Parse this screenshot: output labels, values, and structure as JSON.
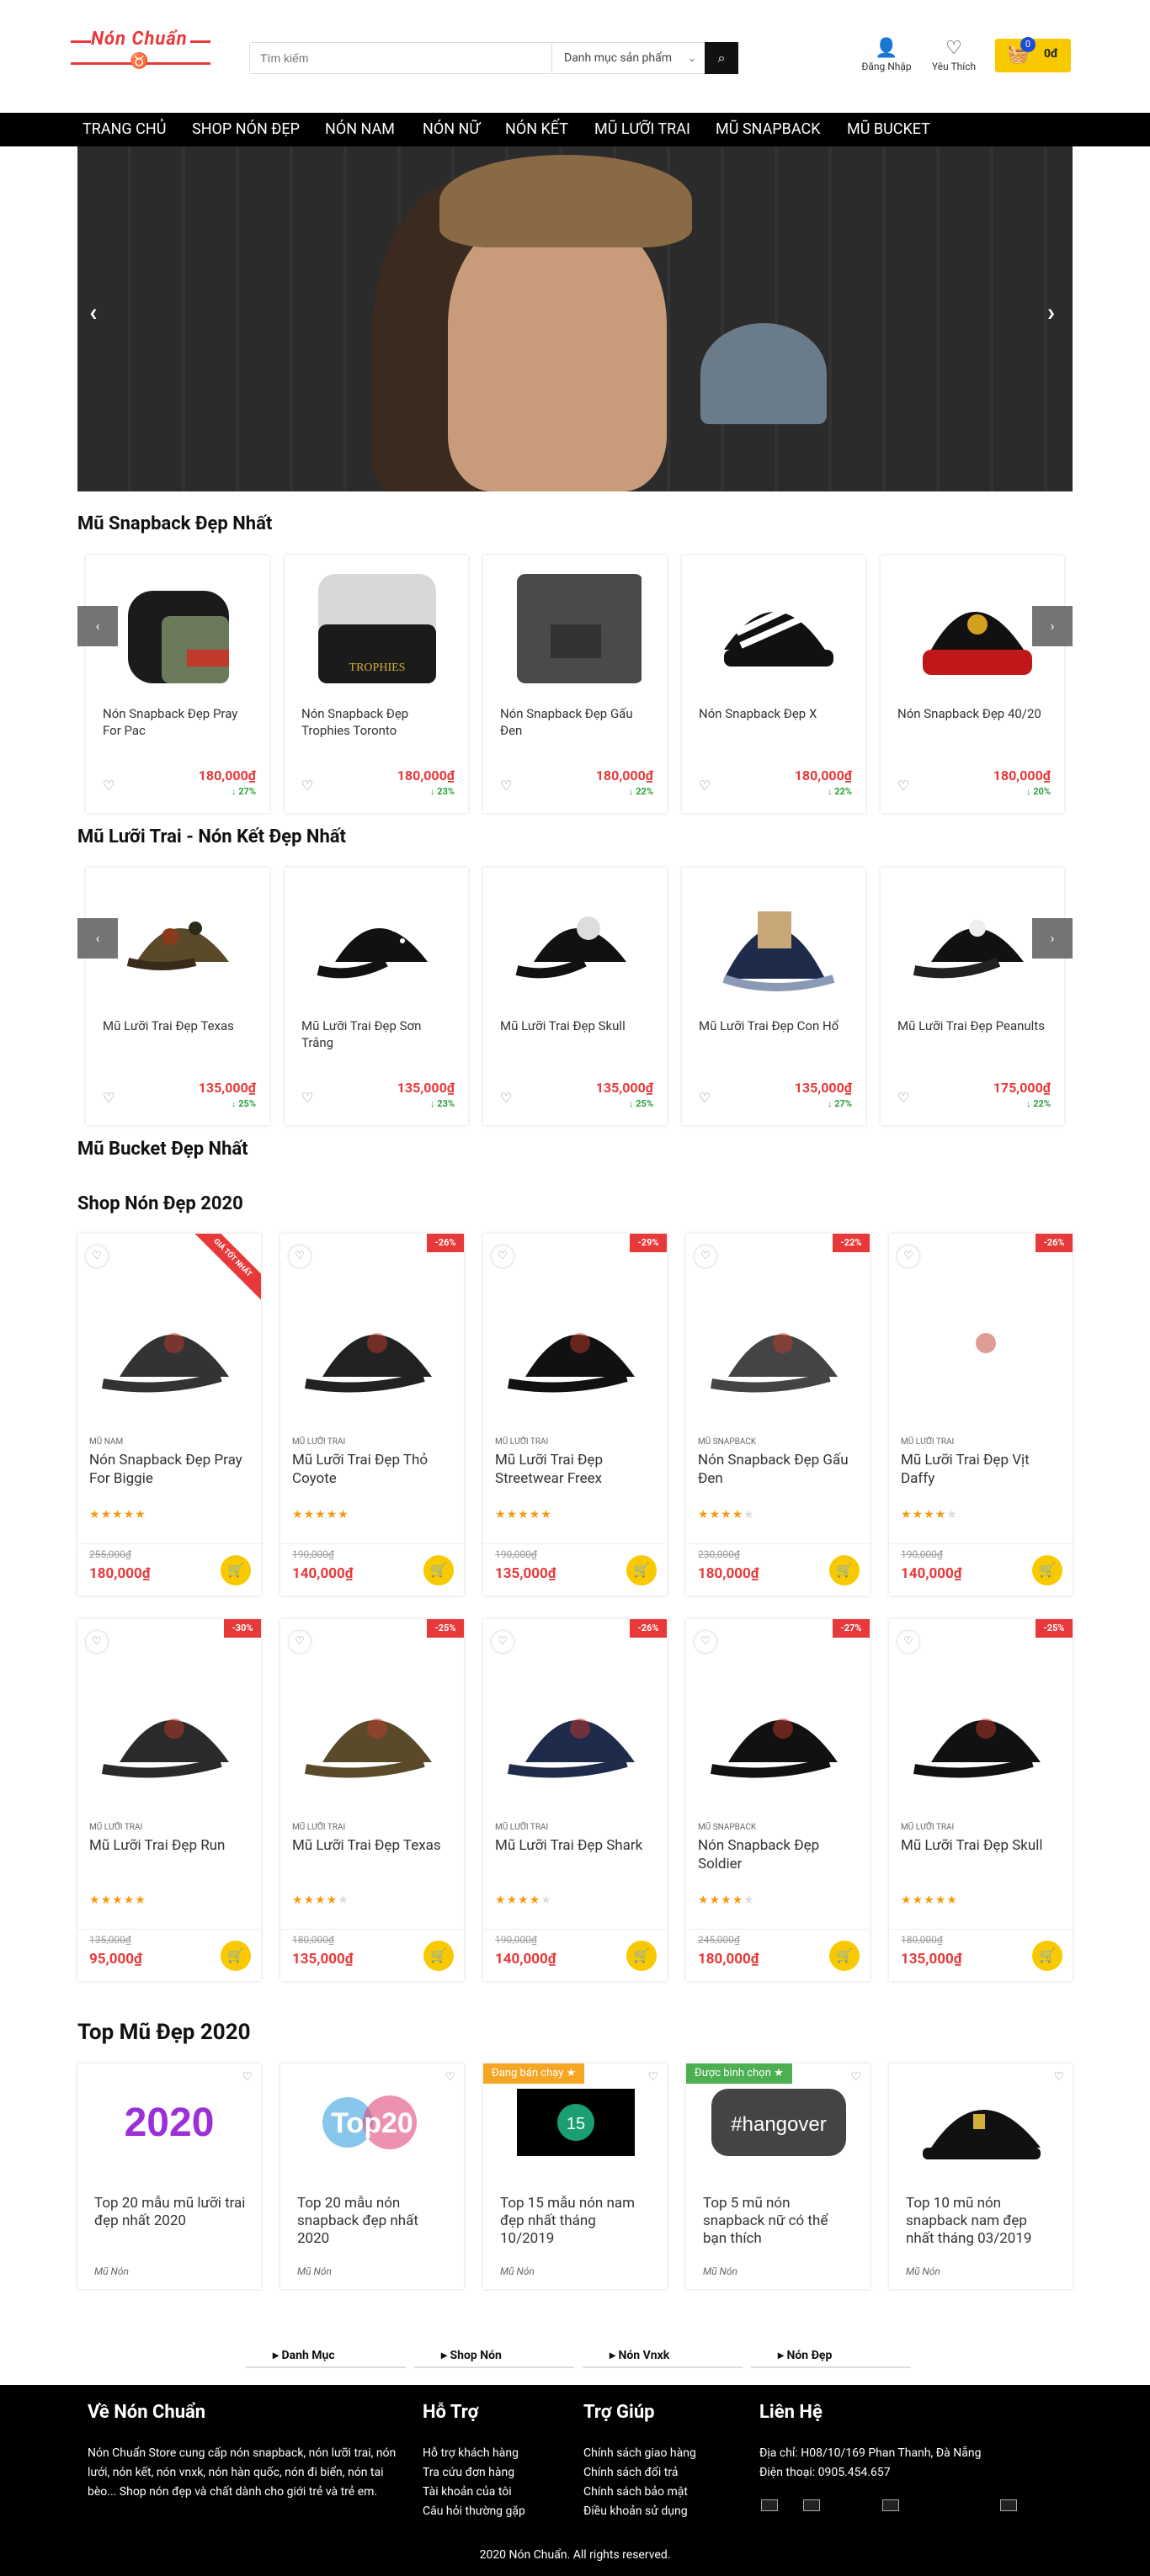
{
  "header": {
    "logo_text": "Nón Chuẩn",
    "search_placeholder": "Tìm kiếm",
    "category_select": "Danh mục sản phẩm",
    "login_label": "Đăng Nhập",
    "wishlist_label": "Yêu Thích",
    "cart_count": "0",
    "cart_total": "0đ"
  },
  "nav": [
    "TRANG CHỦ",
    "SHOP NÓN ĐẸP",
    "NÓN NAM",
    "NÓN NỮ",
    "NÓN KẾT",
    "MŨ LƯỠI TRAI",
    "MŨ SNAPBACK",
    "MŨ BUCKET"
  ],
  "sections": {
    "snapback": "Mũ Snapback Đẹp Nhất",
    "luoi_trai": "Mũ Lưỡi Trai - Nón Kết Đẹp Nhất",
    "bucket": "Mũ Bucket Đẹp Nhất",
    "shop": "Shop Nón Đẹp 2020",
    "top": "Top Mũ Đẹp 2020"
  },
  "snapback_items": [
    {
      "name": "Nón Snapback Đẹp Pray For Pac",
      "price": "180,000₫",
      "discount": "27%"
    },
    {
      "name": "Nón Snapback Đẹp Trophies Toronto",
      "price": "180,000₫",
      "discount": "23%"
    },
    {
      "name": "Nón Snapback Đẹp Gấu Đen",
      "price": "180,000₫",
      "discount": "22%"
    },
    {
      "name": "Nón Snapback Đẹp X",
      "price": "180,000₫",
      "discount": "22%"
    },
    {
      "name": "Nón Snapback Đẹp 40/20",
      "price": "180,000₫",
      "discount": "20%"
    }
  ],
  "luoi_trai_items": [
    {
      "name": "Mũ Lưỡi Trai Đẹp Texas",
      "price": "135,000₫",
      "discount": "25%"
    },
    {
      "name": "Mũ Lưỡi Trai Đẹp Sơn Trắng",
      "price": "135,000₫",
      "discount": "23%"
    },
    {
      "name": "Mũ Lưỡi Trai Đẹp Skull",
      "price": "135,000₫",
      "discount": "25%"
    },
    {
      "name": "Mũ Lưỡi Trai Đẹp Con Hổ",
      "price": "135,000₫",
      "discount": "27%"
    },
    {
      "name": "Mũ Lưỡi Trai Đẹp Peanults",
      "price": "175,000₫",
      "discount": "22%"
    }
  ],
  "shop_items": [
    {
      "cat": "MŨ NAM",
      "name": "Nón Snapback Đẹp Pray For Biggie",
      "stars": 5,
      "old": "255,000₫",
      "new": "180,000₫",
      "pct": "",
      "ribbon": "GIÁ TỐT NHẤT"
    },
    {
      "cat": "MŨ LƯỠI TRAI",
      "name": "Mũ Lưỡi Trai Đẹp Thỏ Coyote",
      "stars": 5,
      "old": "190,000₫",
      "new": "140,000₫",
      "pct": "-26%",
      "ribbon": ""
    },
    {
      "cat": "MŨ LƯỠI TRAI",
      "name": "Mũ Lưỡi Trai Đẹp Streetwear Freex",
      "stars": 5,
      "old": "190,000₫",
      "new": "135,000₫",
      "pct": "-29%",
      "ribbon": ""
    },
    {
      "cat": "MŨ SNAPBACK",
      "name": "Nón Snapback Đẹp Gấu Đen",
      "stars": 4,
      "old": "230,000₫",
      "new": "180,000₫",
      "pct": "-22%",
      "ribbon": ""
    },
    {
      "cat": "MŨ LƯỠI TRAI",
      "name": "Mũ Lưỡi Trai Đẹp Vịt Daffy",
      "stars": 4,
      "old": "190,000₫",
      "new": "140,000₫",
      "pct": "-26%",
      "ribbon": ""
    },
    {
      "cat": "MŨ LƯỠI TRAI",
      "name": "Mũ Lưỡi Trai Đẹp Run",
      "stars": 5,
      "old": "135,000₫",
      "new": "95,000₫",
      "pct": "-30%",
      "ribbon": ""
    },
    {
      "cat": "MŨ LƯỠI TRAI",
      "name": "Mũ Lưỡi Trai Đẹp Texas",
      "stars": 4,
      "old": "180,000₫",
      "new": "135,000₫",
      "pct": "-25%",
      "ribbon": ""
    },
    {
      "cat": "MŨ LƯỠI TRAI",
      "name": "Mũ Lưỡi Trai Đẹp Shark",
      "stars": 4,
      "old": "190,000₫",
      "new": "140,000₫",
      "pct": "-26%",
      "ribbon": ""
    },
    {
      "cat": "MŨ SNAPBACK",
      "name": "Nón Snapback Đẹp Soldier",
      "stars": 4,
      "old": "245,000₫",
      "new": "180,000₫",
      "pct": "-27%",
      "ribbon": ""
    },
    {
      "cat": "MŨ LƯỠI TRAI",
      "name": "Mũ Lưỡi Trai Đẹp Skull",
      "stars": 5,
      "old": "180,000₫",
      "new": "135,000₫",
      "pct": "-25%",
      "ribbon": ""
    }
  ],
  "blog_items": [
    {
      "title": "Top 20 mẫu mũ lưỡi trai đẹp nhất 2020",
      "cat": "Mũ Nón",
      "tag": ""
    },
    {
      "title": "Top 20 mẫu nón snapback đẹp nhất 2020",
      "cat": "Mũ Nón",
      "tag": ""
    },
    {
      "title": "Top 15 mẫu nón nam đẹp nhất tháng 10/2019",
      "cat": "Mũ Nón",
      "tag": "Đang bán chạy ★"
    },
    {
      "title": "Top 5 mũ nón snapback nữ có thể bạn thích",
      "cat": "Mũ Nón",
      "tag": "Được bình chọn ★"
    },
    {
      "title": "Top 10 mũ nón snapback nam đẹp nhất tháng 03/2019",
      "cat": "Mũ Nón",
      "tag": ""
    }
  ],
  "tabs": [
    "Danh Mục",
    "Shop Nón",
    "Nón Vnxk",
    "Nón Đẹp"
  ],
  "footer": {
    "about_title": "Về Nón Chuẩn",
    "about_text": "Nón Chuẩn Store cung cấp nón snapback, nón lưỡi trai, nón lưới, nón kết, nón vnxk, nón hàn quốc, nón đi biển, nón tai bèo... Shop nón đẹp và chất dành cho giới trẻ và trẻ em.",
    "support_title": "Hỗ Trợ",
    "support_links": [
      "Hỗ trợ khách hàng",
      "Tra cứu đơn hàng",
      "Tài khoản của tôi",
      "Câu hỏi thường gặp"
    ],
    "help_title": "Trợ Giúp",
    "help_links": [
      "Chính sách giao hàng",
      "Chính sách đổi trả",
      "Chính sách bảo mật",
      "Điều khoản sử dụng"
    ],
    "contact_title": "Liên Hệ",
    "address": "Địa chỉ: H08/10/169 Phan Thanh, Đà Nẵng",
    "phone": "Điện thoại: 0905.454.657",
    "copyright": "2020 Nón Chuẩn. All rights reserved."
  },
  "colors": {
    "accent": "#e8393a",
    "yellow": "#f9c900",
    "nav_bg": "#000000"
  }
}
